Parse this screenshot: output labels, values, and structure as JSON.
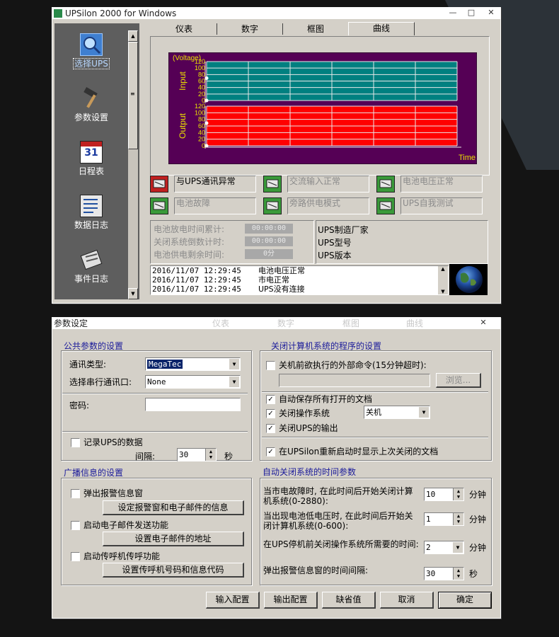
{
  "main_window": {
    "title": "UPSilon 2000 for Windows",
    "sidebar": [
      {
        "label": "选择UPS",
        "icon": "magnifier-icon",
        "selected": true
      },
      {
        "label": "参数设置",
        "icon": "hammer-icon"
      },
      {
        "label": "日程表",
        "icon": "calendar-icon",
        "day": "31"
      },
      {
        "label": "数据日志",
        "icon": "data-log-icon"
      },
      {
        "label": "事件日志",
        "icon": "event-log-icon"
      }
    ],
    "tabs": [
      "仪表",
      "数字",
      "框图",
      "曲线"
    ],
    "active_tab": "曲线",
    "chart": {
      "ylabel_top": "(Voltage)",
      "input_label": "Input",
      "output_label": "Output",
      "time_label": "Time",
      "input_ticks": [
        "120",
        "100",
        "80",
        "60",
        "40",
        "20",
        "0"
      ],
      "output_ticks": [
        "120",
        "100",
        "80",
        "60",
        "40",
        "20",
        "0"
      ],
      "input_color": "#008080",
      "output_color": "#ff0000",
      "background_color": "#550055"
    },
    "status_items": [
      {
        "label": "与UPS通讯异常",
        "icon": "comm-error-icon",
        "active": true
      },
      {
        "label": "交流输入正常",
        "icon": "ac-plug-icon",
        "active": false
      },
      {
        "label": "电池电压正常",
        "icon": "battery-icon",
        "active": false
      },
      {
        "label": "电池故障",
        "icon": "battery-fault-icon",
        "active": false
      },
      {
        "label": "旁路供电模式",
        "icon": "bypass-icon",
        "active": false
      },
      {
        "label": "UPS自我测试",
        "icon": "self-test-icon",
        "active": false
      }
    ],
    "timers": [
      {
        "label": "电池放电时间累计:",
        "value": "00:00:00"
      },
      {
        "label": "关闭系统倒数计时:",
        "value": "00:00:00"
      },
      {
        "label": "电池供电剩余时间:",
        "value": "0分"
      }
    ],
    "ups_info": [
      "UPS制造厂家",
      "UPS型号",
      "UPS版本"
    ],
    "log": [
      {
        "time": "2016/11/07 12:29:45",
        "msg": "电池电压正常"
      },
      {
        "time": "2016/11/07 12:29:45",
        "msg": "市电正常"
      },
      {
        "time": "2016/11/07 12:29:45",
        "msg": "UPS没有连接"
      }
    ]
  },
  "dialog": {
    "title": "参数设定",
    "general": {
      "heading": "公共参数的设置",
      "comm_type_label": "通讯类型:",
      "comm_type_value": "MegaTec",
      "serial_port_label": "选择串行通讯口:",
      "serial_port_value": "None",
      "password_label": "密码:",
      "password_value": "",
      "record_label": "记录UPS的数据",
      "record_checked": false,
      "interval_label": "间隔:",
      "interval_value": "30",
      "interval_unit": "秒"
    },
    "broadcast": {
      "heading": "广播信息的设置",
      "popup_label": "弹出报警信息窗",
      "popup_checked": false,
      "popup_button": "设定报警窗和电子邮件的信息",
      "email_label": "启动电子邮件发送功能",
      "email_checked": false,
      "email_button": "设置电子邮件的地址",
      "pager_label": "启动传呼机传呼功能",
      "pager_checked": false,
      "pager_button": "设置传呼机号码和信息代码"
    },
    "shutdown": {
      "heading": "关闭计算机系统的程序的设置",
      "ext_cmd_label": "关机前欲执行的外部命令(15分钟超时):",
      "ext_cmd_checked": false,
      "ext_cmd_value": "",
      "browse_button": "浏览...",
      "autosave_label": "自动保存所有打开的文档",
      "autosave_checked": true,
      "close_os_label": "关闭操作系统",
      "close_os_checked": true,
      "close_os_value": "关机",
      "close_ups_label": "关闭UPS的输出",
      "close_ups_checked": true,
      "show_docs_label": "在UPSilon重新启动时显示上次关闭的文档",
      "show_docs_checked": true
    },
    "timing": {
      "heading": "自动关闭系统的时间参数",
      "rows": [
        {
          "label": "当市电故障时, 在此时间后开始关闭计算机系统(0-2880):",
          "value": "10",
          "unit": "分钟",
          "control": "spin"
        },
        {
          "label": "当出现电池低电压时, 在此时间后开始关闭计算机系统(0-600):",
          "value": "1",
          "unit": "分钟",
          "control": "spin"
        },
        {
          "label": "在UPS停机前关闭操作系统所需要的时间:",
          "value": "2",
          "unit": "分钟",
          "control": "dropdown"
        },
        {
          "label": "弹出报警信息窗的时间间隔:",
          "value": "30",
          "unit": "秒",
          "control": "spin"
        }
      ]
    },
    "buttons": {
      "import": "输入配置",
      "export": "输出配置",
      "default": "缺省值",
      "cancel": "取消",
      "ok": "确定"
    },
    "behind_tabs": [
      "仪表",
      "数字",
      "框图",
      "曲线"
    ]
  }
}
